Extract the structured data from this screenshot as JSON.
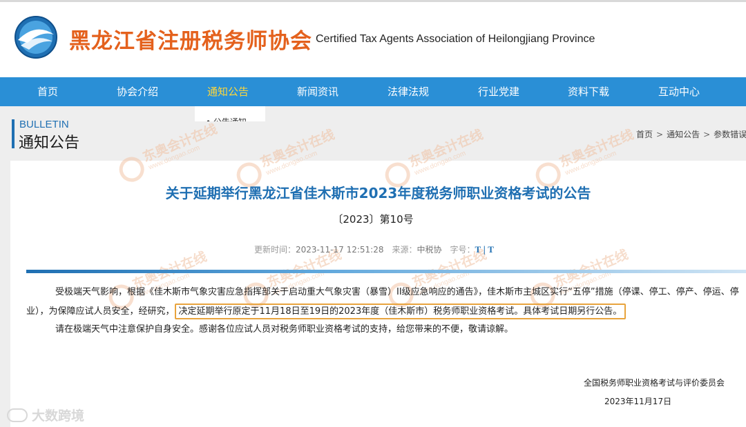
{
  "header": {
    "title_cn": "黑龙江省注册税务师协会",
    "title_en": "Certified Tax Agents Association of Heilongjiang Province",
    "logo_icon": "globe-logo-icon"
  },
  "nav": {
    "items": [
      {
        "label": "首页"
      },
      {
        "label": "协会介绍"
      },
      {
        "label": "通知公告",
        "active": true
      },
      {
        "label": "新闻资讯"
      },
      {
        "label": "法律法规"
      },
      {
        "label": "行业党建"
      },
      {
        "label": "资料下载"
      },
      {
        "label": "互动中心"
      }
    ],
    "dropdown_item": "• 公告通知"
  },
  "section": {
    "title_en": "BULLETIN",
    "title_cn": "通知公告"
  },
  "breadcrumb": {
    "items": [
      "首页",
      "通知公告",
      "参数错误"
    ],
    "separator": ">"
  },
  "article": {
    "title": "关于延期举行黑龙江省佳木斯市2023年度税务师职业资格考试的公告",
    "doc_number": "〔2023〕第10号",
    "meta": {
      "updated_label": "更新时间：",
      "updated_value": "2023-11-17 12:51:28",
      "source_label": "来源：",
      "source_value": "中税协",
      "font_size_label": "字号：",
      "font_btn_1": "T",
      "font_btn_2": "T",
      "font_separator": "|"
    },
    "p1_line1": "受极端天气影响，根据《佳木斯市气象灾害应急指挥部关于启动重大气象灾害（暴雪）II级应急响应的通告》，佳木斯市主城区实行“五停”措施（停课、停工、停产、停运、停",
    "p1_line2_start": "业），为保障应试人员安全，经研究，",
    "p1_line2_highlight": "决定延期举行原定于11月18日至19日的2023年度（佳木斯市）税务师职业资格考试。具体考试日期另行公告。",
    "p2": "请在极端天气中注意保护自身安全。感谢各位应试人员对税务师职业资格考试的支持，给您带来的不便，敬请谅解。",
    "signature_org": "全国税务师职业资格考试与评价委员会",
    "signature_date": "2023年11月17日"
  },
  "watermark": {
    "cn": "东奥会计在线",
    "en": "www.dongao.com",
    "corner": "大数跨境"
  },
  "colors": {
    "brand_orange": "#e4611d",
    "nav_blue": "#2a8fd6",
    "nav_active": "#ffd73a",
    "title_blue": "#1f6fb2",
    "highlight_border": "#e8a33c"
  }
}
